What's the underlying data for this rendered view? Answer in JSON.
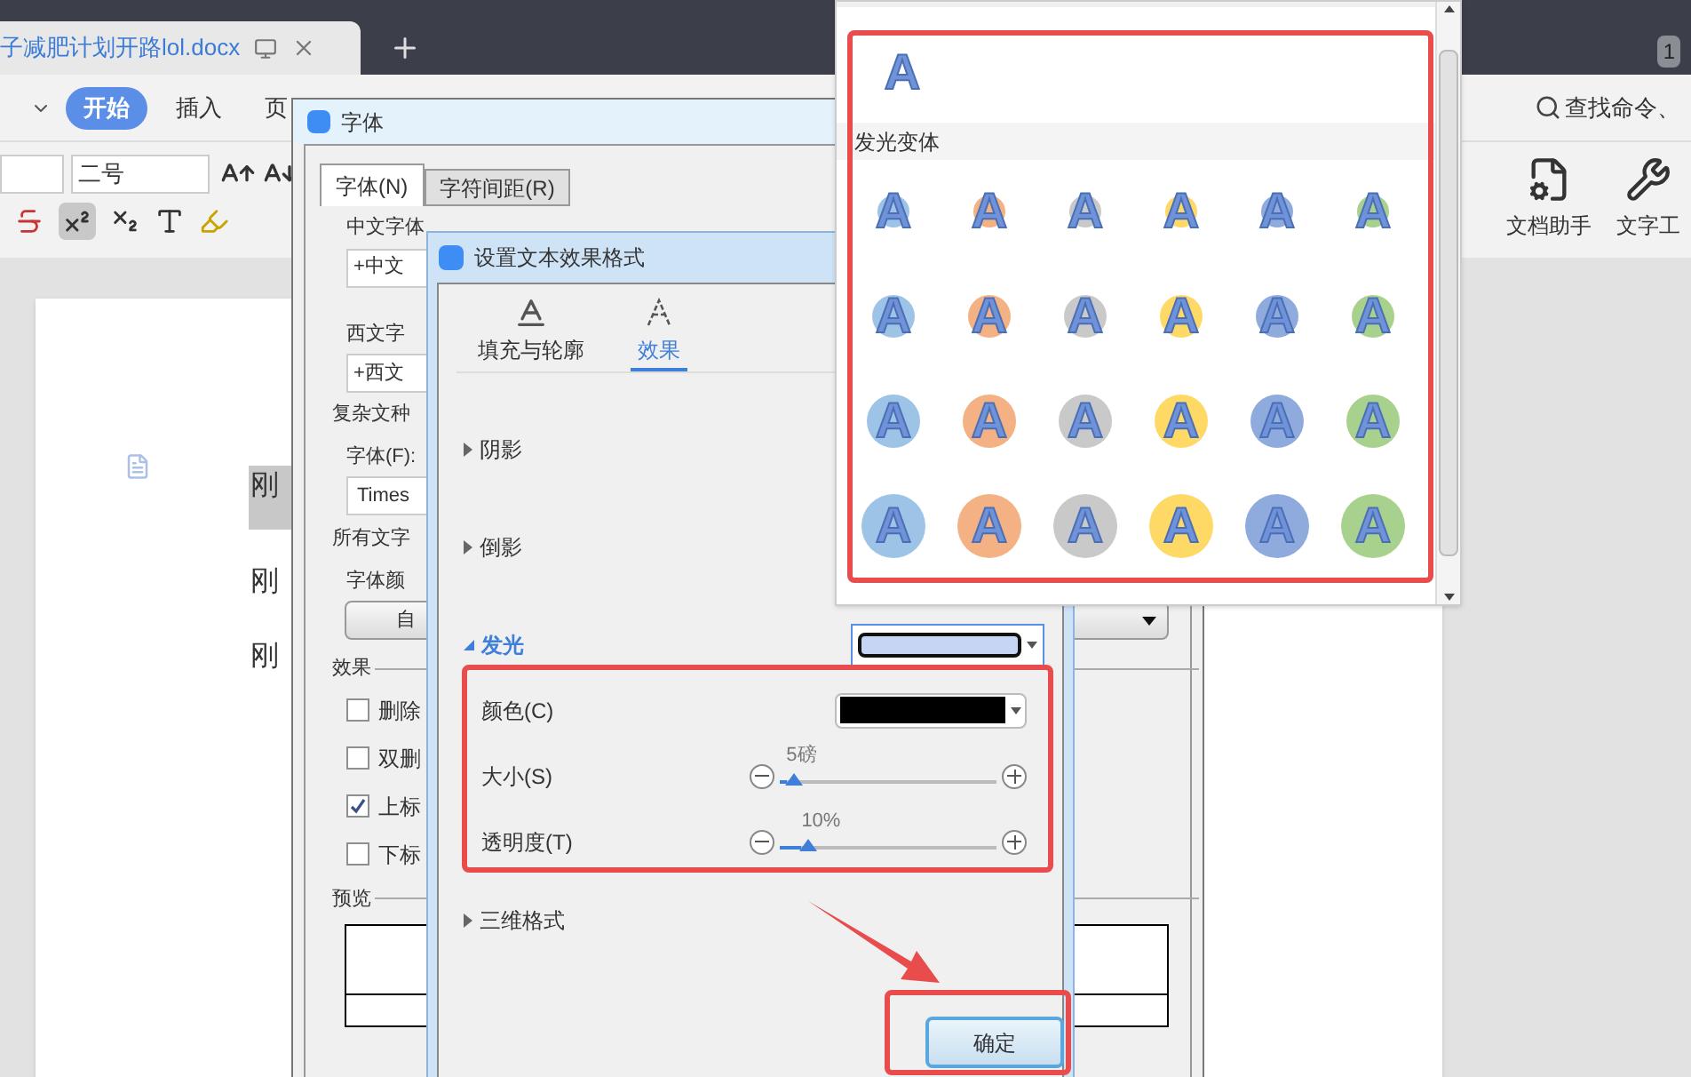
{
  "document_tab": {
    "title": "子减肥计划开路lol.docx"
  },
  "notification_count": "1",
  "menu": [
    {
      "label": "开始",
      "selected": true
    },
    {
      "label": "插入",
      "selected": false
    },
    {
      "label": "页",
      "selected": false
    }
  ],
  "search": {
    "placeholder": "查找命令、"
  },
  "font_size": {
    "value": "二号"
  },
  "tools": [
    {
      "label": "文档助手",
      "kind": "assistant"
    },
    {
      "label": "文字工",
      "kind": "wrench"
    }
  ],
  "document_lines": [
    {
      "text": "刚",
      "selected": true
    },
    {
      "text": "刚",
      "selected": false
    },
    {
      "text": "刚",
      "selected": false
    }
  ],
  "font_dialog": {
    "title": "字体",
    "tabs": [
      {
        "label": "字体(N)",
        "selected": true
      },
      {
        "label": "字符间距(R)",
        "selected": false
      }
    ],
    "chinese_font": {
      "label": "中文字体",
      "value": "+中文"
    },
    "western_font": {
      "label": "西文字",
      "value": "+西文"
    },
    "complex_group": "复杂文种",
    "complex_font": {
      "label": "字体(F):",
      "value": "Times"
    },
    "all_text_group": "所有文字",
    "font_color": {
      "label": "字体颜",
      "value": "自"
    },
    "effects_group": "效果",
    "effects": [
      {
        "label": "删除",
        "checked": false
      },
      {
        "label": "双删",
        "checked": false
      },
      {
        "label": "上标",
        "checked": true
      },
      {
        "label": "下标",
        "checked": false
      }
    ],
    "preview_group": "预览"
  },
  "effects_dialog": {
    "title": "设置文本效果格式",
    "tabs": [
      {
        "label": "填充与轮廓",
        "selected": false,
        "kind": "fill"
      },
      {
        "label": "效果",
        "selected": true,
        "kind": "effects"
      }
    ],
    "sections": [
      {
        "label": "阴影",
        "expanded": false
      },
      {
        "label": "倒影",
        "expanded": false
      },
      {
        "label": "发光",
        "expanded": true,
        "color": "#c6d5f3",
        "properties": [
          {
            "kind": "color",
            "label": "颜色(C)",
            "color": "#000000"
          },
          {
            "kind": "slider",
            "label": "大小(S)",
            "reading": "5磅",
            "level": 0.03
          },
          {
            "kind": "slider",
            "label": "透明度(T)",
            "reading": "10%",
            "level": 0.1
          }
        ]
      },
      {
        "label": "三维格式",
        "expanded": false
      }
    ],
    "ok_button": "确定"
  },
  "glow_gallery": {
    "none_item": {
      "label": "A"
    },
    "header": "发光变体",
    "rows": [
      {
        "kind": "small",
        "items": [
          {
            "label": "A",
            "color": "#9dc3e6"
          },
          {
            "label": "A",
            "color": "#f4b183"
          },
          {
            "label": "A",
            "color": "#c9c9c9"
          },
          {
            "label": "A",
            "color": "#ffd966"
          },
          {
            "label": "A",
            "color": "#8faadc"
          },
          {
            "label": "A",
            "color": "#a9d18e"
          }
        ]
      },
      {
        "kind": "medium",
        "items": [
          {
            "label": "A",
            "color": "#9dc3e6"
          },
          {
            "label": "A",
            "color": "#f4b183"
          },
          {
            "label": "A",
            "color": "#c9c9c9"
          },
          {
            "label": "A",
            "color": "#ffd966"
          },
          {
            "label": "A",
            "color": "#8faadc"
          },
          {
            "label": "A",
            "color": "#a9d18e"
          }
        ]
      },
      {
        "kind": "large",
        "items": [
          {
            "label": "A",
            "color": "#9dc3e6"
          },
          {
            "label": "A",
            "color": "#f4b183"
          },
          {
            "label": "A",
            "color": "#c9c9c9"
          },
          {
            "label": "A",
            "color": "#ffd966"
          },
          {
            "label": "A",
            "color": "#8faadc"
          },
          {
            "label": "A",
            "color": "#a9d18e"
          }
        ]
      },
      {
        "kind": "xlarge",
        "items": [
          {
            "label": "A",
            "color": "#9dc3e6"
          },
          {
            "label": "A",
            "color": "#f4b183"
          },
          {
            "label": "A",
            "color": "#c9c9c9"
          },
          {
            "label": "A",
            "color": "#ffd966"
          },
          {
            "label": "A",
            "color": "#8faadc"
          },
          {
            "label": "A",
            "color": "#a9d18e"
          }
        ]
      }
    ]
  }
}
